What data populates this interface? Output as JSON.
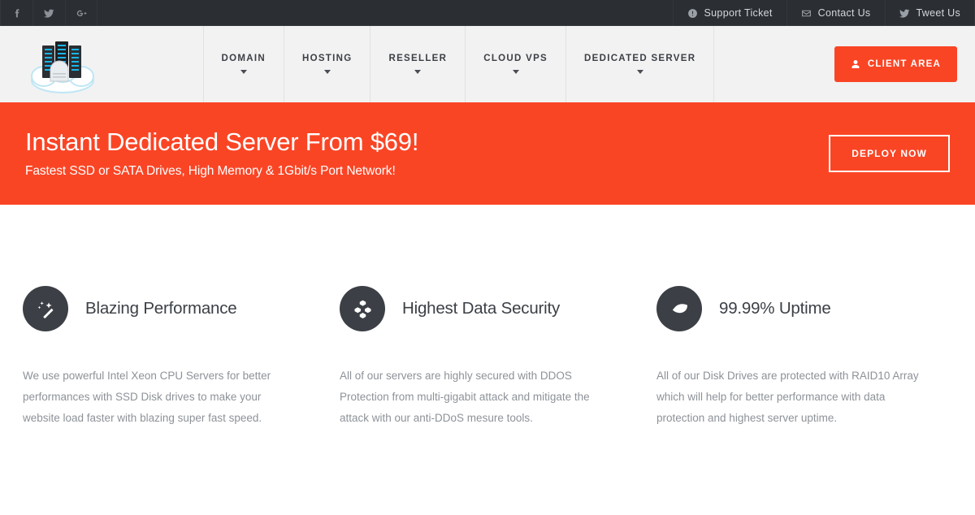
{
  "topbar": {
    "social": [
      {
        "name": "facebook-icon",
        "label": "Facebook"
      },
      {
        "name": "twitter-icon",
        "label": "Twitter"
      },
      {
        "name": "google-plus-icon",
        "label": "Google Plus"
      }
    ],
    "links": [
      {
        "icon": "exclamation-circle-icon",
        "label": "Support Ticket"
      },
      {
        "icon": "envelope-icon",
        "label": "Contact Us"
      },
      {
        "icon": "twitter-icon",
        "label": "Tweet Us"
      }
    ]
  },
  "header": {
    "logo_alt": "server-cloud-logo",
    "nav": [
      {
        "label": "DOMAIN",
        "has_dropdown": true
      },
      {
        "label": "HOSTING",
        "has_dropdown": true
      },
      {
        "label": "RESELLER",
        "has_dropdown": true
      },
      {
        "label": "CLOUD VPS",
        "has_dropdown": true
      },
      {
        "label": "DEDICATED SERVER",
        "has_dropdown": true
      }
    ],
    "client_area_label": "CLIENT AREA"
  },
  "hero": {
    "title": "Instant Dedicated Server From $69!",
    "subtitle": "Fastest SSD or SATA Drives, High Memory & 1Gbit/s Port Network!",
    "cta_label": "DEPLOY NOW"
  },
  "features": [
    {
      "icon": "magic-wand-icon",
      "title": "Blazing Performance",
      "text": "We use powerful Intel Xeon CPU Servers for better performances with SSD Disk drives to make your website load faster with blazing super fast speed."
    },
    {
      "icon": "cubes-icon",
      "title": "Highest Data Security",
      "text": "All of our servers are highly secured with DDOS Protection from multi-gigabit attack and mitigate the attack with our anti-DDoS mesure tools."
    },
    {
      "icon": "leaf-icon",
      "title": "99.99% Uptime",
      "text": "All of our Disk Drives are protected with RAID10 Array which will help for better performance with data protection and highest server uptime."
    }
  ],
  "colors": {
    "accent": "#fa4525",
    "topbar_bg": "#2b2e33",
    "header_bg": "#f2f2f2",
    "icon_circle": "#3c4046",
    "body_text": "#8d9298"
  }
}
